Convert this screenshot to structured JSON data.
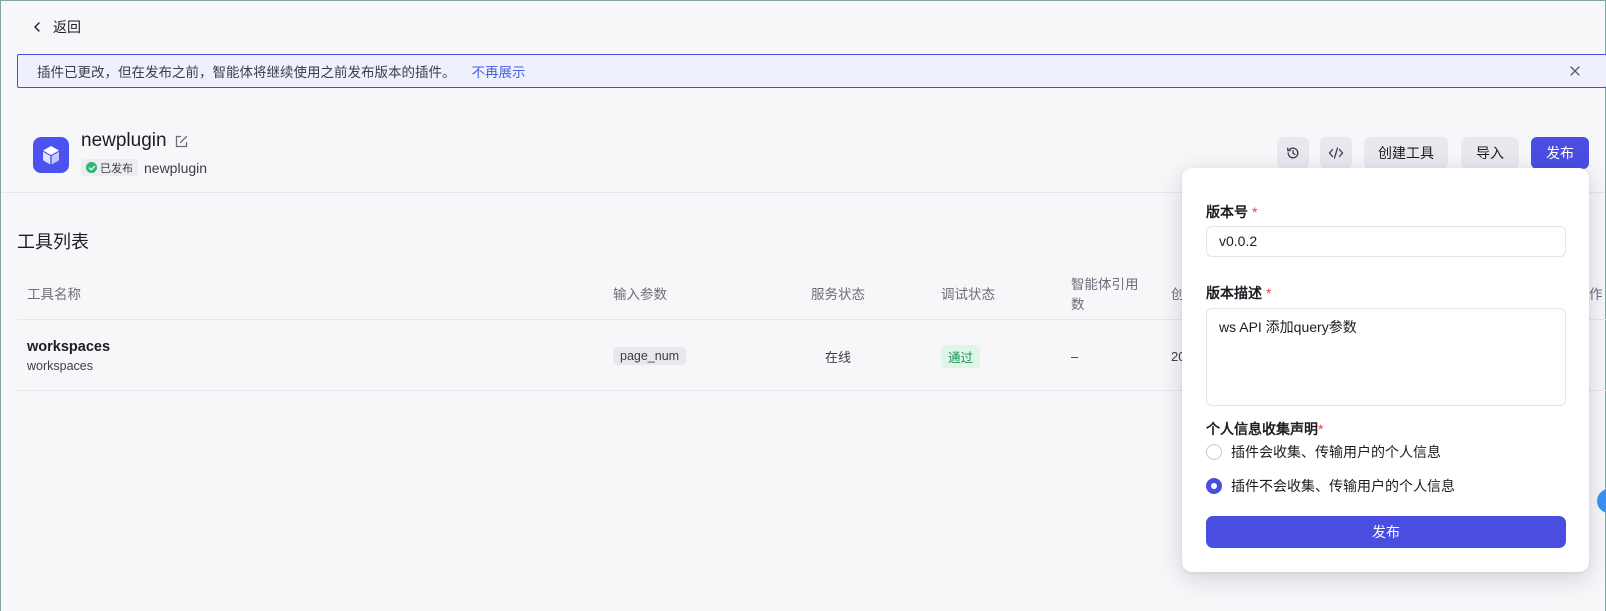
{
  "nav": {
    "back_label": "返回"
  },
  "banner": {
    "message": "插件已更改，但在发布之前，智能体将继续使用之前发布版本的插件。",
    "link_label": "不再展示"
  },
  "plugin": {
    "name": "newplugin",
    "status_badge": "已发布",
    "sub_name": "newplugin"
  },
  "header_actions": {
    "create_tool_label": "创建工具",
    "import_label": "导入",
    "publish_label": "发布"
  },
  "tools": {
    "title": "工具列表",
    "columns": [
      "工具名称",
      "输入参数",
      "服务状态",
      "调试状态",
      "智能体引用用数",
      "创"
    ],
    "col_agent_ref_line1": "智能体引用",
    "col_agent_ref_line2": "数",
    "rows": [
      {
        "name": "workspaces",
        "desc": "workspaces",
        "param": "page_num",
        "service_status": "在线",
        "debug_status": "通过",
        "agent_refs": "–",
        "created_partial": "20"
      }
    ],
    "trailing_col_fragment": "作"
  },
  "publish_popover": {
    "version_label": "版本号",
    "version_value": "v0.0.2",
    "desc_label": "版本描述",
    "desc_value": "ws API 添加query参数",
    "privacy_label": "个人信息收集声明",
    "option_collect": "插件会收集、传输用户的个人信息",
    "option_no_collect": "插件不会收集、传输用户的个人信息",
    "selected_option": "option_no_collect",
    "submit_label": "发布"
  },
  "colors": {
    "primary": "#4a4ee0",
    "success": "#2bb673",
    "required": "#e53e3e"
  }
}
